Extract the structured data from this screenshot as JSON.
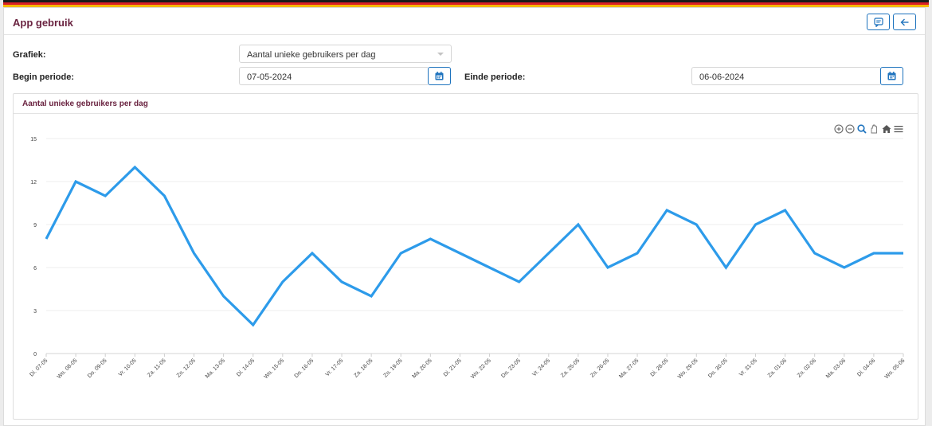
{
  "app": {
    "title": "App gebruik"
  },
  "header": {
    "comment_icon": "comment-icon",
    "back_icon": "arrow-left-icon"
  },
  "colors": {
    "flag_black": "#1a1a1a",
    "flag_red": "#d81f26",
    "flag_gold": "#f5b800",
    "title": "#6a2340",
    "line": "#2d9bea",
    "accent": "#1e73be"
  },
  "form": {
    "grafiek_label": "Grafiek:",
    "grafiek_value": "Aantal unieke gebruikers per dag",
    "begin_label": "Begin periode:",
    "begin_value": "07-05-2024",
    "einde_label": "Einde periode:",
    "einde_value": "06-06-2024"
  },
  "card": {
    "title": "Aantal unieke gebruikers per dag"
  },
  "toolbar": [
    "zoom-in-icon",
    "zoom-out-icon",
    "magnifier-icon",
    "pan-hand-icon",
    "home-icon",
    "menu-icon"
  ],
  "chart_data": {
    "type": "line",
    "title": "",
    "xlabel": "",
    "ylabel": "",
    "ylim": [
      0,
      15
    ],
    "yticks": [
      0,
      3,
      6,
      9,
      12,
      15
    ],
    "grid": true,
    "categories": [
      "Di. 07-05",
      "Wo. 08-05",
      "Do. 09-05",
      "Vr. 10-05",
      "Za. 11-05",
      "Zo. 12-05",
      "Ma. 13-05",
      "Di. 14-05",
      "Wo. 15-05",
      "Do. 16-05",
      "Vr. 17-05",
      "Za. 18-05",
      "Zo. 19-05",
      "Ma. 20-05",
      "Di. 21-05",
      "Wo. 22-05",
      "Do. 23-05",
      "Vr. 24-05",
      "Za. 25-05",
      "Zo. 26-05",
      "Ma. 27-05",
      "Di. 28-05",
      "Wo. 29-05",
      "Do. 30-05",
      "Vr. 31-05",
      "Za. 01-06",
      "Zo. 02-06",
      "Ma. 03-06",
      "Di. 04-06",
      "Wo. 05-06"
    ],
    "values": [
      8,
      12,
      11,
      13,
      11,
      7,
      4,
      2,
      5,
      7,
      5,
      4,
      7,
      8,
      7,
      6,
      5,
      7,
      9,
      6,
      7,
      10,
      9,
      6,
      9,
      10,
      7,
      6,
      7,
      7
    ]
  }
}
